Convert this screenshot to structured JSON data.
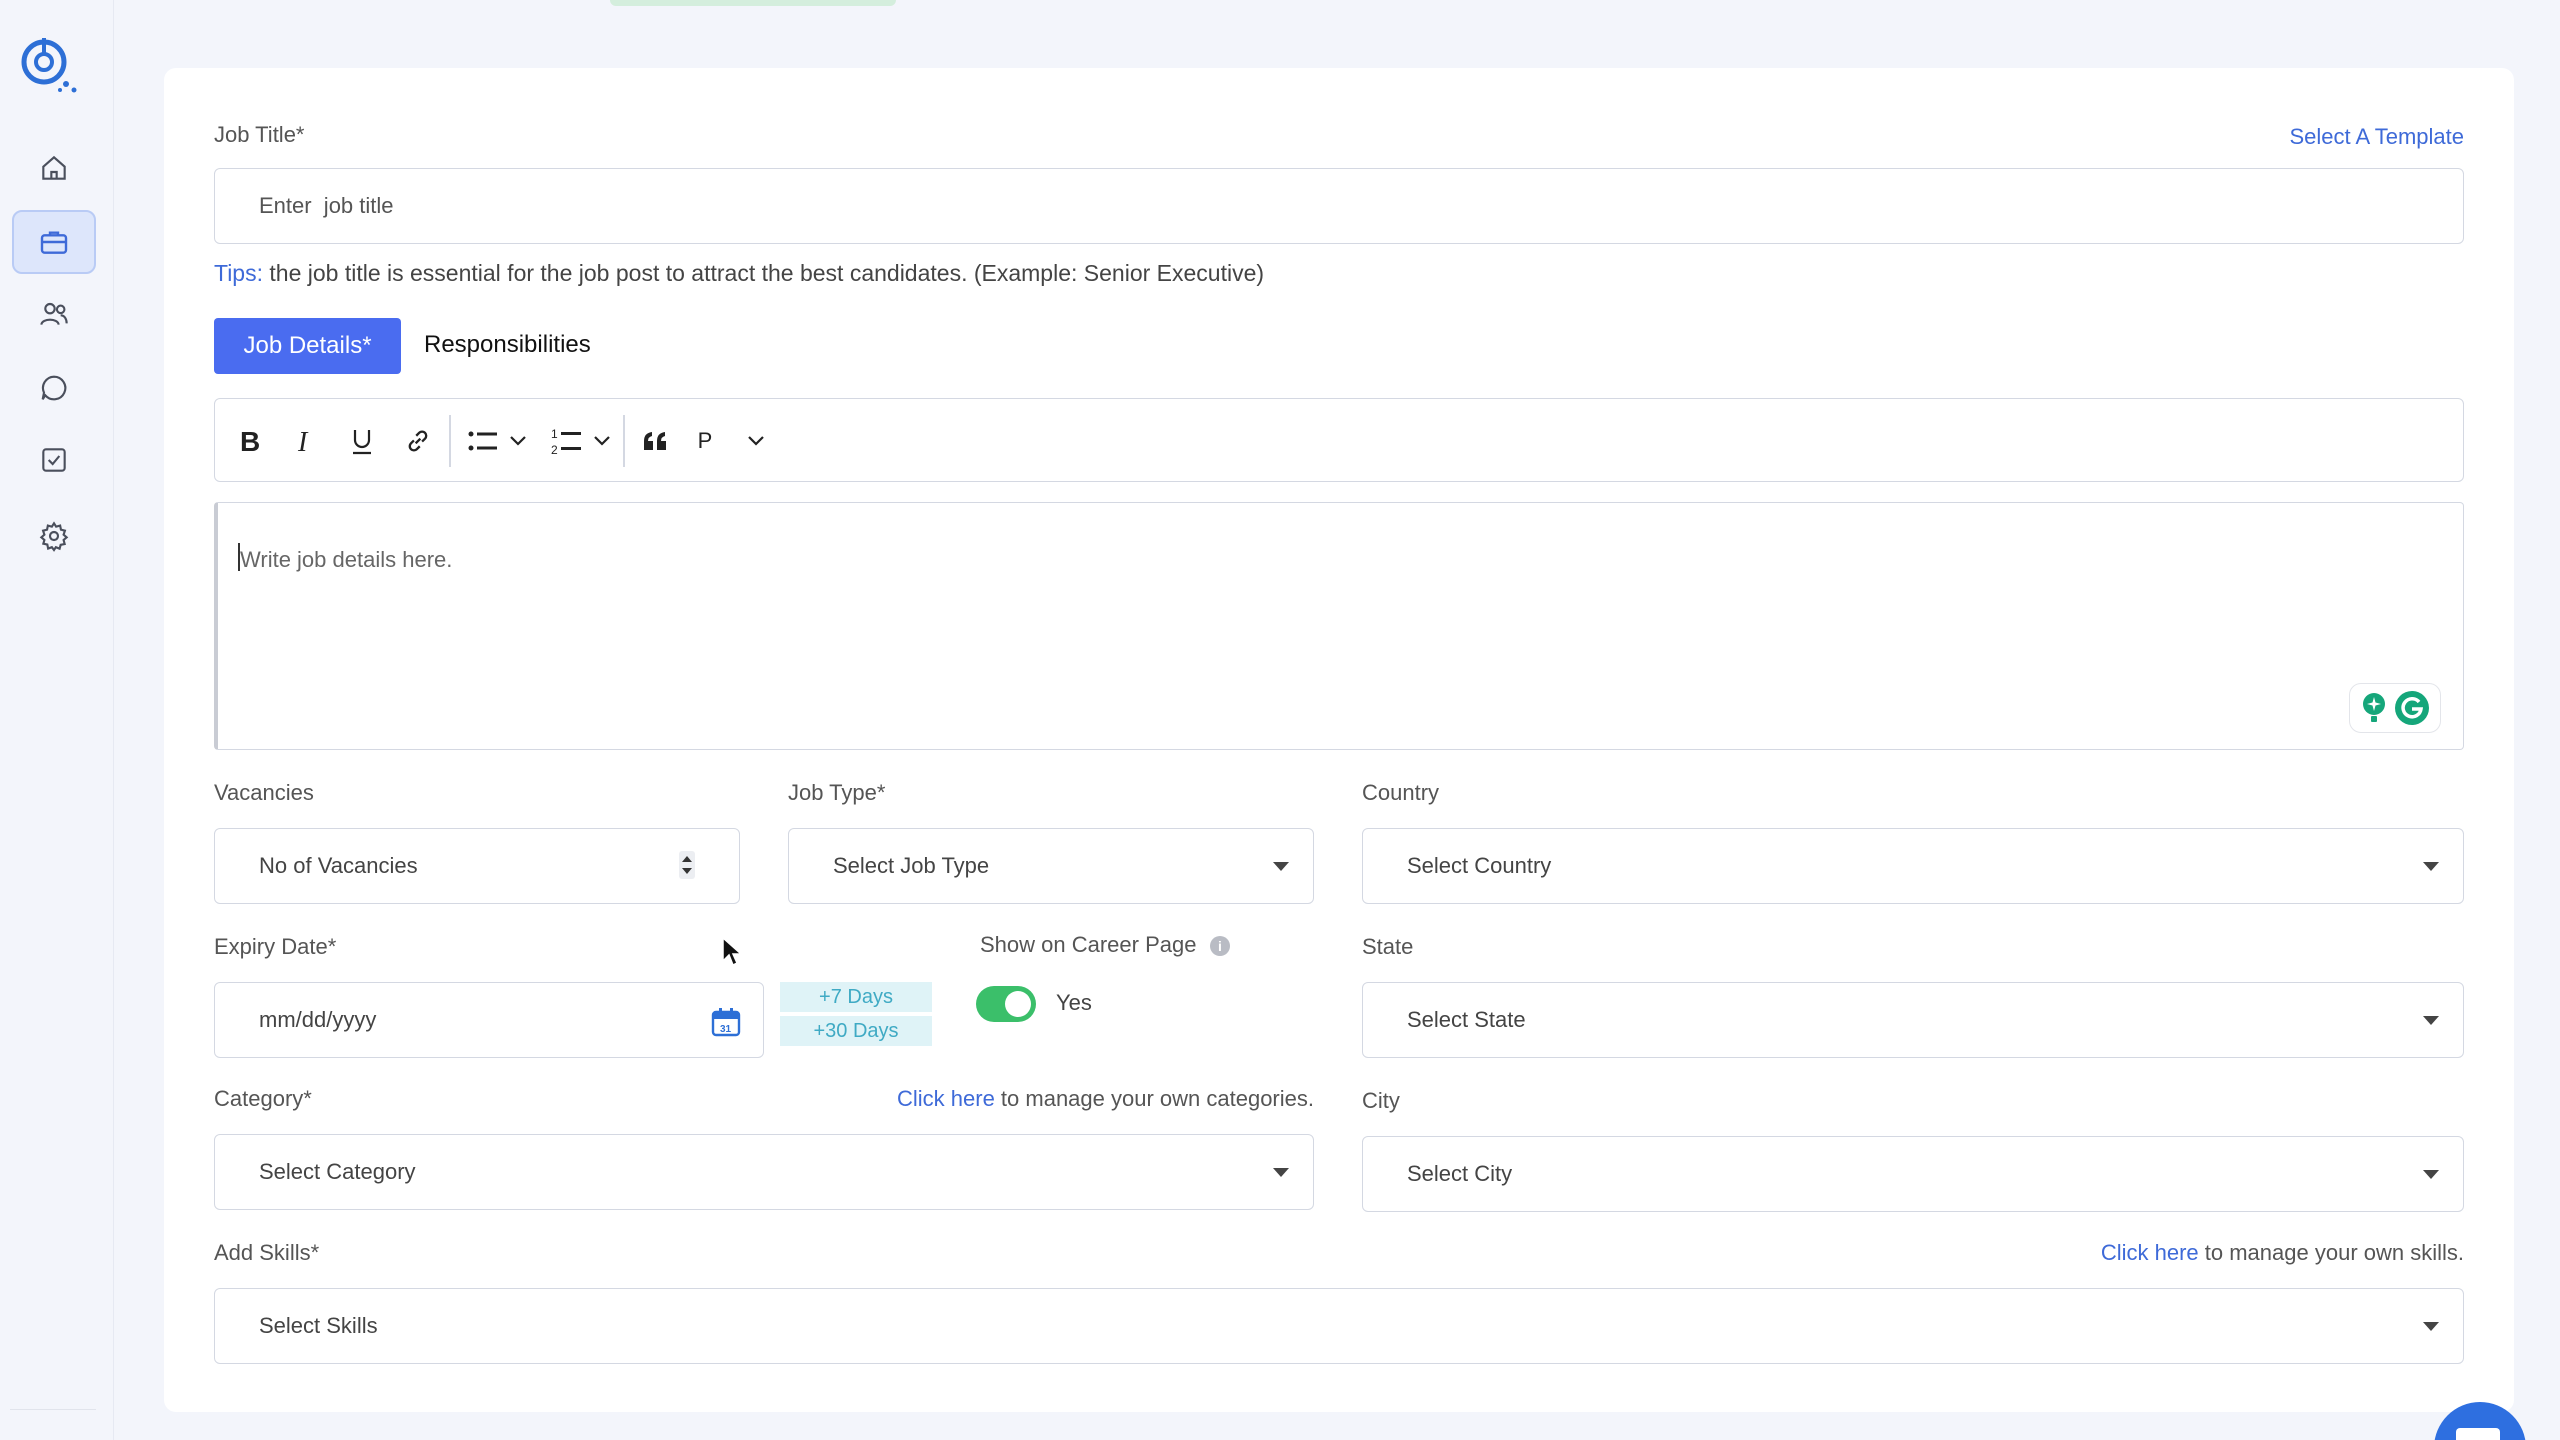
{
  "sidebar": {
    "logo": "app-logo",
    "items": [
      {
        "icon": "home-icon",
        "active": false
      },
      {
        "icon": "briefcase-icon",
        "active": true
      },
      {
        "icon": "users-icon",
        "active": false
      },
      {
        "icon": "chat-icon",
        "active": false
      },
      {
        "icon": "checklist-icon",
        "active": false
      },
      {
        "icon": "gear-icon",
        "active": false
      }
    ]
  },
  "form": {
    "job_title_label": "Job Title*",
    "select_template": "Select A Template",
    "job_title_placeholder": "Enter  job title",
    "tips_prefix": "Tips:",
    "tips_text": " the job title is essential for the job post to attract the best candidates. (Example: Senior Executive)",
    "tabs": [
      "Job Details*",
      "Responsibilities"
    ],
    "toolbar": {
      "paragraph_label": "P"
    },
    "editor_placeholder": "Write job details here.",
    "vacancies_label": "Vacancies",
    "vacancies_placeholder": "No of Vacancies",
    "job_type_label": "Job Type*",
    "job_type_placeholder": "Select Job Type",
    "country_label": "Country",
    "country_placeholder": "Select Country",
    "expiry_label": "Expiry Date*",
    "expiry_placeholder": "mm/dd/yyyy",
    "plus_7": "+7 Days",
    "plus_30": "+30 Days",
    "career_label": "Show on Career Page",
    "career_value": "Yes",
    "career_enabled": true,
    "state_label": "State",
    "state_placeholder": "Select State",
    "category_label": "Category*",
    "category_link": "Click here",
    "category_link_suffix": " to manage your own categories.",
    "category_placeholder": "Select Category",
    "city_label": "City",
    "city_placeholder": "Select City",
    "skills_label": "Add Skills*",
    "skills_link": "Click here",
    "skills_link_suffix": " to manage your own skills.",
    "skills_placeholder": "Select Skills"
  },
  "colors": {
    "accent": "#4a6cf0",
    "link": "#3e6ad8",
    "toggle_on": "#3bbf6a",
    "chip_bg": "#dff3f7",
    "chip_text": "#3faac4"
  }
}
